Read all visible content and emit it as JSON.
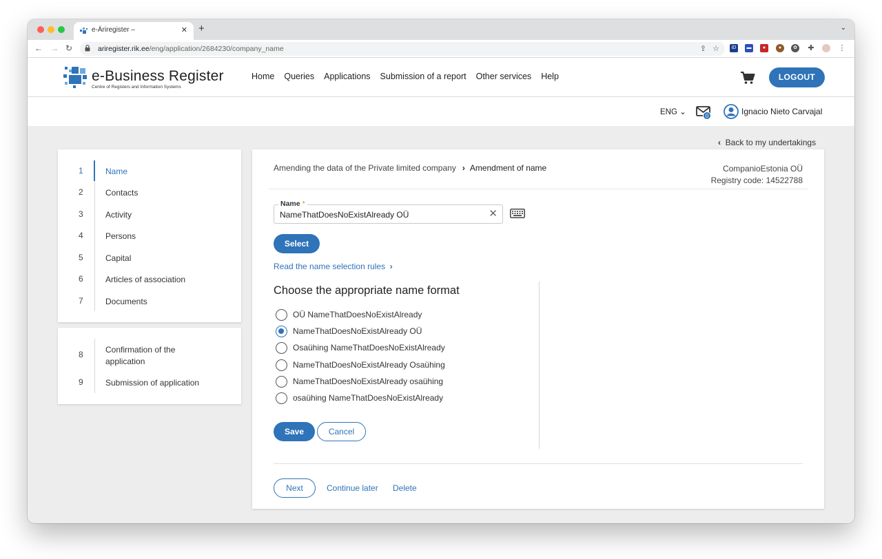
{
  "browser": {
    "tab_title": "e-Äriregister –",
    "tab_close": "✕",
    "new_tab": "+",
    "url_host": "ariregister.rik.ee",
    "url_path": "/eng/application/2684230/company_name"
  },
  "header": {
    "logo_title": "e-Business Register",
    "logo_subtitle": "Centre of Registers and Information Systems",
    "nav": [
      "Home",
      "Queries",
      "Applications",
      "Submission of a report",
      "Other services",
      "Help"
    ],
    "logout_label": "LOGOUT"
  },
  "user_bar": {
    "language": "ENG",
    "mail_count": "0",
    "user_name": "Ignacio Nieto Carvajal"
  },
  "back_link": "Back to my undertakings",
  "steps": [
    {
      "number": "1",
      "label": "Name",
      "active": true
    },
    {
      "number": "2",
      "label": "Contacts"
    },
    {
      "number": "3",
      "label": "Activity"
    },
    {
      "number": "4",
      "label": "Persons"
    },
    {
      "number": "5",
      "label": "Capital"
    },
    {
      "number": "6",
      "label": "Articles of association"
    },
    {
      "number": "7",
      "label": "Documents"
    }
  ],
  "steps_final": [
    {
      "number": "8",
      "label_line1": "Confirmation of the",
      "label_line2": "application"
    },
    {
      "number": "9",
      "label": "Submission of application"
    }
  ],
  "breadcrumb": {
    "parent": "Amending the data of the Private limited company",
    "separator": "›",
    "current": "Amendment of name"
  },
  "company": {
    "name": "CompanioEstonia OÜ",
    "registry_code": "Registry code: 14522788"
  },
  "form": {
    "name_label": "Name",
    "required_mark": "*",
    "name_value": "NameThatDoesNoExistAlready OÜ",
    "clear_icon": "✕",
    "select_label": "Select",
    "rules_link": "Read the name selection rules",
    "format_title": "Choose the appropriate name format",
    "format_options": [
      {
        "label": "OÜ NameThatDoesNoExistAlready",
        "checked": false
      },
      {
        "label": "NameThatDoesNoExistAlready OÜ",
        "checked": true
      },
      {
        "label": "Osaühing NameThatDoesNoExistAlready",
        "checked": false
      },
      {
        "label": "NameThatDoesNoExistAlready Osaühing",
        "checked": false
      },
      {
        "label": "NameThatDoesNoExistAlready osaühing",
        "checked": false
      },
      {
        "label": "osaühing NameThatDoesNoExistAlready",
        "checked": false
      }
    ],
    "save_label": "Save",
    "cancel_label": "Cancel"
  },
  "footer_actions": {
    "next_label": "Next",
    "continue_label": "Continue later",
    "delete_label": "Delete"
  },
  "colors": {
    "accent": "#2f73b8",
    "required": "#e08a00"
  }
}
